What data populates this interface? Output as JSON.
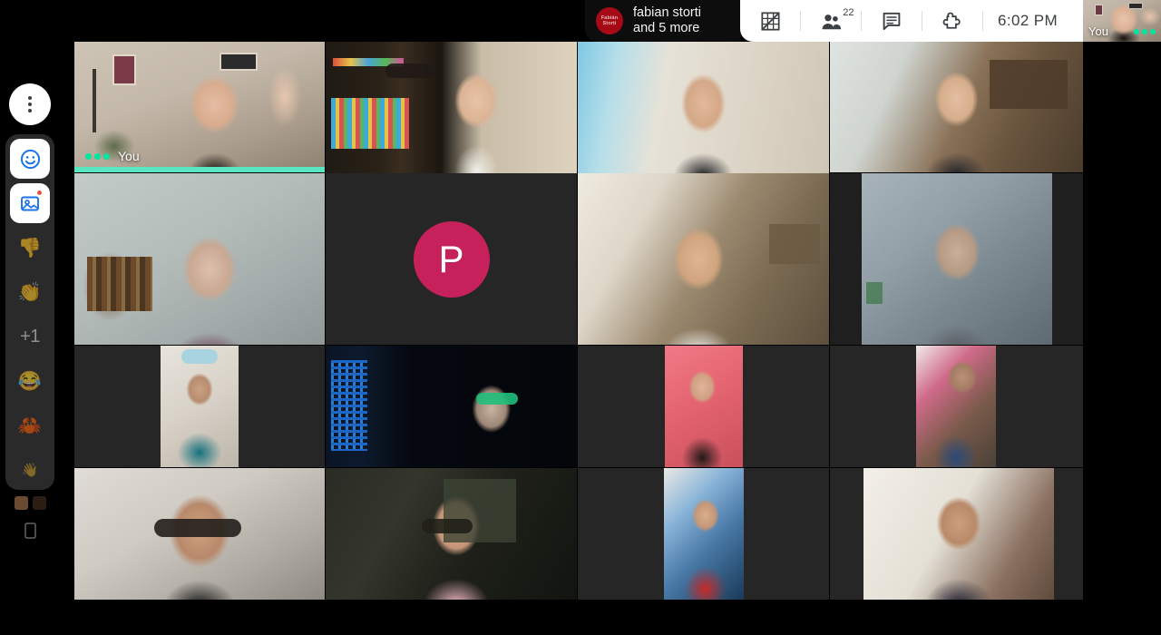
{
  "topbar": {
    "speaker_chip": {
      "avatar_initials": "Fabián Storti",
      "avatar_line1": "Fabián",
      "avatar_line2": "Storti",
      "avatar_color": "#a60a17",
      "name_line1": "fabian storti",
      "name_line2": "and 5 more"
    },
    "buttons": [
      {
        "name": "grid-view-off-icon",
        "label": "Change layout"
      },
      {
        "name": "people-icon",
        "label": "Participants",
        "count": "22"
      },
      {
        "name": "chat-icon",
        "label": "Chat"
      },
      {
        "name": "puzzle-icon",
        "label": "Apps"
      }
    ],
    "time": "6:02 PM",
    "selfview": {
      "label": "You",
      "speaking": true
    }
  },
  "sidebar": {
    "more_button": {
      "name": "more-options-button",
      "label": "More options"
    },
    "reactions": [
      {
        "name": "reactions-smiley-button",
        "glyph": "😃",
        "label": "Reactions",
        "active": true,
        "badge": false
      },
      {
        "name": "effects-button",
        "glyph": "🖼",
        "label": "Effects",
        "active": true,
        "badge": true
      },
      {
        "name": "thumbs-down-button",
        "glyph": "👎",
        "label": "Thumbs down",
        "active": false,
        "badge": false
      },
      {
        "name": "clap-button",
        "glyph": "👏",
        "label": "Clap",
        "active": false,
        "badge": false
      },
      {
        "name": "plus-one-button",
        "glyph": "+1",
        "label": "Plus one",
        "active": false,
        "badge": false
      },
      {
        "name": "laughing-button",
        "glyph": "😂",
        "label": "Laughing",
        "active": false,
        "badge": false
      },
      {
        "name": "crab-button",
        "glyph": "🦀",
        "label": "Crab",
        "active": false,
        "badge": false
      },
      {
        "name": "wave-hand-button",
        "glyph": "👋",
        "label": "Wave",
        "active": false,
        "badge": false
      }
    ],
    "skin_tones": [
      {
        "name": "skin-tone-medium",
        "color": "#6b4a32"
      },
      {
        "name": "skin-tone-dark",
        "color": "#2b1d14"
      }
    ],
    "bottom_icon": {
      "name": "phone-icon",
      "glyph": "⬜",
      "label": "Device"
    }
  },
  "grid": {
    "participants": [
      {
        "id": "p1",
        "label": "You",
        "speaking": true,
        "type": "video"
      },
      {
        "id": "p2",
        "label": "",
        "speaking": false,
        "type": "video"
      },
      {
        "id": "p3",
        "label": "",
        "speaking": false,
        "type": "video"
      },
      {
        "id": "p4",
        "label": "",
        "speaking": false,
        "type": "video"
      },
      {
        "id": "p5",
        "label": "",
        "speaking": false,
        "type": "video"
      },
      {
        "id": "p6",
        "label": "",
        "speaking": false,
        "type": "avatar",
        "initial": "P",
        "avatar_color": "#c7215b"
      },
      {
        "id": "p7",
        "label": "",
        "speaking": false,
        "type": "video"
      },
      {
        "id": "p8",
        "label": "",
        "speaking": false,
        "type": "video"
      },
      {
        "id": "p9",
        "label": "",
        "speaking": false,
        "type": "video"
      },
      {
        "id": "p10",
        "label": "",
        "speaking": false,
        "type": "video"
      },
      {
        "id": "p11",
        "label": "",
        "speaking": false,
        "type": "video"
      },
      {
        "id": "p12",
        "label": "",
        "speaking": false,
        "type": "video"
      },
      {
        "id": "p13",
        "label": "",
        "speaking": false,
        "type": "video"
      },
      {
        "id": "p14",
        "label": "",
        "speaking": false,
        "type": "video"
      },
      {
        "id": "p15",
        "label": "",
        "speaking": false,
        "type": "video"
      },
      {
        "id": "p16",
        "label": "",
        "speaking": false,
        "type": "video"
      }
    ]
  }
}
